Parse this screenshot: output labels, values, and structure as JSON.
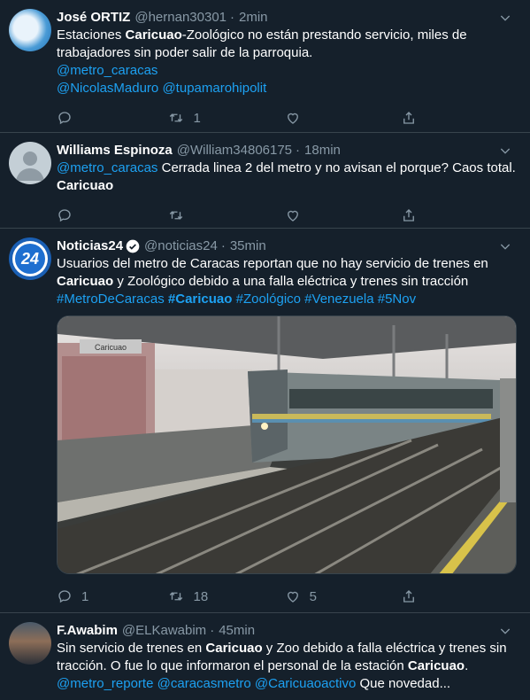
{
  "tweets": [
    {
      "name": "José ORTIZ",
      "handle": "@hernan30301",
      "dot": "·",
      "time": "2min",
      "text_a": "Estaciones ",
      "text_b": "Caricuao",
      "text_c": "-Zoológico no están prestando servicio, miles de trabajadores sin poder salir de la parroquia.",
      "mention1": "@metro_caracas",
      "mention2": "@NicolasMaduro",
      "mention3": "@tupamarohipolit",
      "reply_count": "",
      "retweet_count": "1",
      "like_count": ""
    },
    {
      "name": "Williams Espinoza",
      "handle": "@William34806175",
      "dot": "·",
      "time": "18min",
      "mention1": "@metro_caracas",
      "text_a": " Cerrada linea 2 del metro y no avisan el porque? Caos total. ",
      "text_b": "Caricuao",
      "reply_count": "",
      "retweet_count": "",
      "like_count": ""
    },
    {
      "name": "Noticias24",
      "handle": "@noticias24",
      "dot": "·",
      "time": "35min",
      "avatar_text": "24",
      "text_a": "Usuarios del metro de Caracas reportan que no hay  servicio de trenes en ",
      "text_b": "Caricuao",
      "text_c": " y Zoológico debido a una falla eléctrica y trenes sin tracción",
      "tag1": "#MetroDeCaracas",
      "tag2": "#Caricuao",
      "tag3": "#Zoológico",
      "tag4": "#Venezuela",
      "tag5": "#5Nov",
      "media_sign": "Caricuao",
      "reply_count": "1",
      "retweet_count": "18",
      "like_count": "5"
    },
    {
      "name": "F.Awabim",
      "handle": "@ELKawabim",
      "dot": "·",
      "time": "45min",
      "text_a": "Sin servicio de trenes en ",
      "text_b": "Caricuao",
      "text_c": " y Zoo debido a falla eléctrica y trenes sin tracción. O fue lo que informaron el personal de la estación ",
      "text_d": "Caricuao",
      "text_e": ".",
      "mention1": "@metro_reporte",
      "mention2": "@caracasmetro",
      "mention3": "@Caricuaoactivo",
      "text_f": "  Que novedad..."
    }
  ],
  "colors": {
    "background": "#15202b",
    "muted": "#8899a6",
    "link": "#1da1f2",
    "border": "#38444d"
  },
  "icons": [
    "reply-icon",
    "retweet-icon",
    "like-icon",
    "share-icon",
    "chevron-down-icon",
    "verified-icon"
  ]
}
